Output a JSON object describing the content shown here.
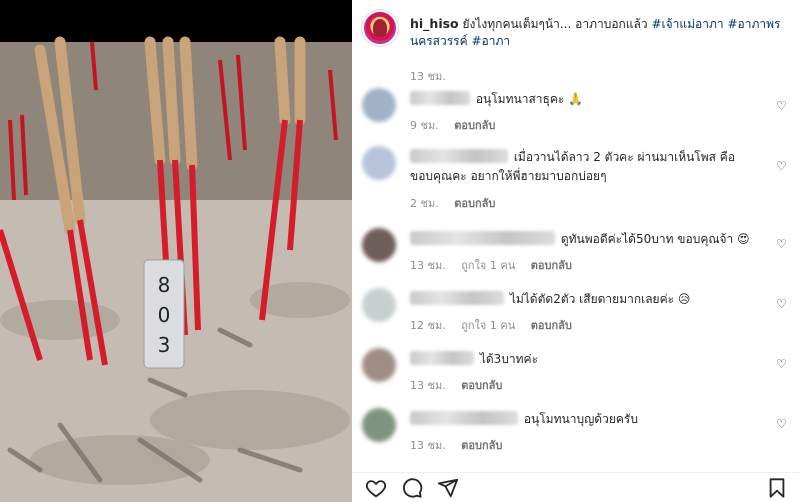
{
  "post": {
    "username": "hi_hiso",
    "caption": "ยังไงทุกคนเต็มๆน้า... อาภาบอกแล้ว",
    "hashtags": [
      "#เจ้าแม่อาภา",
      "#อาภาพรนครสวรรค์",
      "#อาภา"
    ],
    "time": "13 ชม.",
    "photo_tag_text": "803"
  },
  "comments": [
    {
      "text": "อนุโมทนาสาธุคะ 🙏",
      "time": "9 ชม.",
      "likes": "",
      "reply": "ตอบกลับ",
      "avatar_color": "#9fb2c7"
    },
    {
      "text": "เมื่อวานได้ลาว 2 ตัวคะ ผ่านมาเห็นโพส คือขอบคุณคะ อยากให้พี่ฮายมาบอกบ่อยๆ",
      "time": "2 ชม.",
      "likes": "",
      "reply": "ตอบกลับ",
      "avatar_color": "#b6c3d9"
    },
    {
      "text": "ดูทันพอดีค่ะได้50บาท ขอบคุณจ้า 😍",
      "time": "13 ชม.",
      "likes": "ถูกใจ 1 คน",
      "reply": "ตอบกลับ",
      "avatar_color": "#6d5e5a"
    },
    {
      "text": "ไม่ได้ตัด2ตัว เสียดายมากเลยค่ะ 😥",
      "time": "12 ชม.",
      "likes": "ถูกใจ 1 คน",
      "reply": "ตอบกลับ",
      "avatar_color": "#c8cfcf"
    },
    {
      "text": "ได้3บาทค่ะ",
      "time": "13 ชม.",
      "likes": "",
      "reply": "ตอบกลับ",
      "avatar_color": "#a08e86"
    },
    {
      "text": "อนุโมทนาบุญด้วยครับ",
      "time": "13 ชม.",
      "likes": "",
      "reply": "ตอบกลับ",
      "avatar_color": "#7f9480"
    }
  ],
  "actions": {
    "like_icon": "heart-icon",
    "comment_icon": "comment-icon",
    "share_icon": "share-icon",
    "save_icon": "bookmark-icon"
  }
}
